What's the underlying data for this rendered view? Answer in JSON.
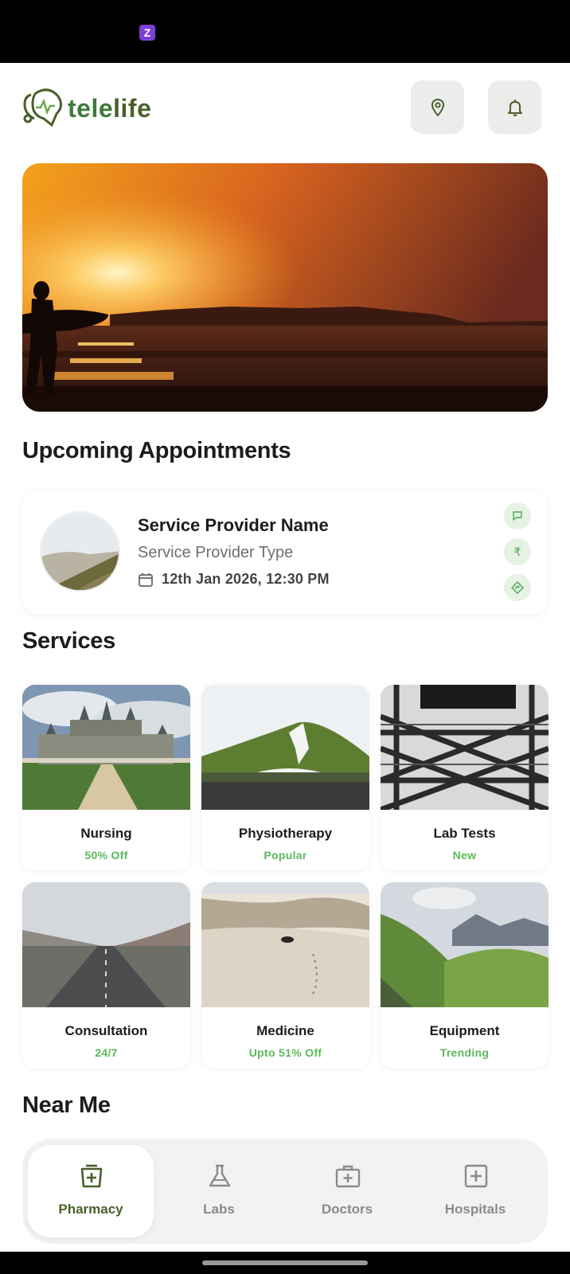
{
  "status_bar": {
    "badge": "Z"
  },
  "header": {
    "logo_text_a": "tele",
    "logo_text_b": "life",
    "location_icon": "location-pin-icon",
    "notification_icon": "bell-icon"
  },
  "appointments": {
    "title": "Upcoming Appointments",
    "card": {
      "name": "Service Provider Name",
      "type": "Service Provider Type",
      "date": "12th Jan 2026, 12:30 PM",
      "actions": [
        "chat-icon",
        "rupee-icon",
        "directions-icon"
      ]
    }
  },
  "services": {
    "title": "Services",
    "items": [
      {
        "name": "Nursing",
        "tag": "50% Off"
      },
      {
        "name": "Physiotherapy",
        "tag": "Popular"
      },
      {
        "name": "Lab Tests",
        "tag": "New"
      },
      {
        "name": "Consultation",
        "tag": "24/7"
      },
      {
        "name": "Medicine",
        "tag": "Upto 51% Off"
      },
      {
        "name": "Equipment",
        "tag": "Trending"
      }
    ]
  },
  "near_me": {
    "title": "Near Me"
  },
  "tabs": [
    {
      "label": "Pharmacy",
      "icon": "pharmacy-icon",
      "active": true
    },
    {
      "label": "Labs",
      "icon": "flask-icon",
      "active": false
    },
    {
      "label": "Doctors",
      "icon": "medical-bag-icon",
      "active": false
    },
    {
      "label": "Hospitals",
      "icon": "hospital-cross-icon",
      "active": false
    }
  ],
  "colors": {
    "brand_green": "#3f7a3a",
    "accent_green": "#5cb85c",
    "olive": "#48602b"
  }
}
